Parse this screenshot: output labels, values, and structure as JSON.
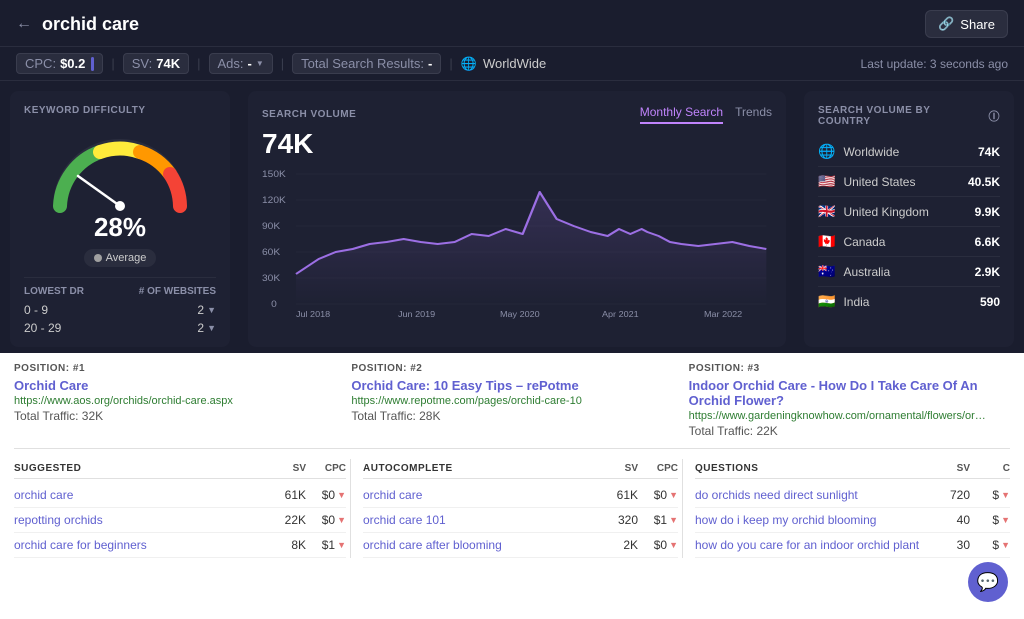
{
  "header": {
    "back_label": "←",
    "title": "orchid care",
    "share_label": "Share",
    "last_update": "Last update: 3 seconds ago"
  },
  "subheader": {
    "cpc_label": "CPC:",
    "cpc_value": "$0.2",
    "sv_label": "SV:",
    "sv_value": "74K",
    "ads_label": "Ads:",
    "ads_value": "-",
    "total_label": "Total Search Results:",
    "total_value": "-",
    "worldwide_label": "WorldWide"
  },
  "keyword_difficulty": {
    "title": "KEYWORD DIFFICULTY",
    "value": "28%",
    "badge": "Average",
    "lowest_dr": "LOWEST DR",
    "websites": "# OF WEBSITES",
    "rows": [
      {
        "range": "0 - 9",
        "count": "2"
      },
      {
        "range": "20 - 29",
        "count": "2"
      }
    ]
  },
  "search_volume": {
    "title": "SEARCH VOLUME",
    "tab_monthly": "Monthly Search",
    "tab_trends": "Trends",
    "volume": "74K",
    "y_labels": [
      "150K",
      "120K",
      "90K",
      "60K",
      "30K",
      "0"
    ],
    "x_labels": [
      "Jul 2018",
      "Jun 2019",
      "May 2020",
      "Apr 2021",
      "Mar 2022"
    ]
  },
  "country_card": {
    "title": "SEARCH VOLUME BY COUNTRY",
    "rows": [
      {
        "flag": "🌐",
        "name": "Worldwide",
        "value": "74K"
      },
      {
        "flag": "🇺🇸",
        "name": "United States",
        "value": "40.5K"
      },
      {
        "flag": "🇬🇧",
        "name": "United Kingdom",
        "value": "9.9K"
      },
      {
        "flag": "🇨🇦",
        "name": "Canada",
        "value": "6.6K"
      },
      {
        "flag": "🇦🇺",
        "name": "Australia",
        "value": "2.9K"
      },
      {
        "flag": "🇮🇳",
        "name": "India",
        "value": "590"
      }
    ]
  },
  "positions": [
    {
      "label": "POSITION: #1",
      "title": "Orchid Care",
      "url": "https://www.aos.org/orchids/orchid-care.aspx",
      "traffic": "Total Traffic: 32K"
    },
    {
      "label": "POSITION: #2",
      "title": "Orchid Care: 10 Easy Tips – rePotme",
      "url": "https://www.repotme.com/pages/orchid-care-10",
      "traffic": "Total Traffic: 28K"
    },
    {
      "label": "POSITION: #3",
      "title": "Indoor Orchid Care - How Do I Take Care Of An Orchid Flower?",
      "url": "https://www.gardeningknowhow.com/ornamental/flowers/orchids/indoor-orchid-care.htm",
      "traffic": "Total Traffic: 22K"
    }
  ],
  "suggested": {
    "title": "SUGGESTED",
    "col_sv": "SV",
    "col_cpc": "CPC",
    "rows": [
      {
        "name": "orchid care",
        "sv": "61K",
        "cpc": "$0",
        "trend": "down"
      },
      {
        "name": "repotting orchids",
        "sv": "22K",
        "cpc": "$0",
        "trend": "down"
      },
      {
        "name": "orchid care for beginners",
        "sv": "8K",
        "cpc": "$1",
        "trend": "down"
      }
    ]
  },
  "autocomplete": {
    "title": "AUTOCOMPLETE",
    "col_sv": "SV",
    "col_cpc": "CPC",
    "rows": [
      {
        "name": "orchid care",
        "sv": "61K",
        "cpc": "$0",
        "trend": "down"
      },
      {
        "name": "orchid care 101",
        "sv": "320",
        "cpc": "$1",
        "trend": "down"
      },
      {
        "name": "orchid care after blooming",
        "sv": "2K",
        "cpc": "$0",
        "trend": "down"
      }
    ]
  },
  "questions": {
    "title": "QUESTIONS",
    "col_sv": "SV",
    "col_c": "C",
    "rows": [
      {
        "name": "do orchids need direct sunlight",
        "sv": "720",
        "cpc": "$",
        "trend": "down"
      },
      {
        "name": "how do i keep my orchid blooming",
        "sv": "40",
        "cpc": "$",
        "trend": "down"
      },
      {
        "name": "how do you care for an indoor orchid plant",
        "sv": "30",
        "cpc": "$",
        "trend": "down"
      }
    ]
  }
}
